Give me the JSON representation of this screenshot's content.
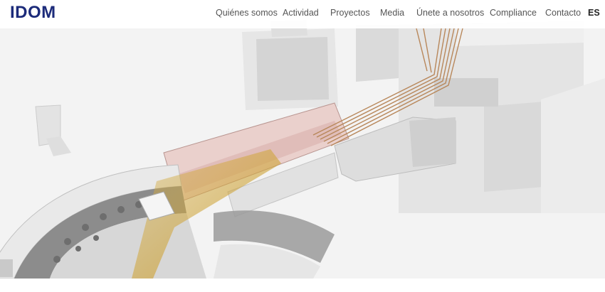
{
  "header": {
    "logo_text": "IDOM",
    "nav": [
      {
        "label": "Quiénes somos"
      },
      {
        "label": "Actividad"
      },
      {
        "label": "Proyectos"
      },
      {
        "label": "Media"
      },
      {
        "label": "Únete a nosotros"
      },
      {
        "label": "Compliance"
      },
      {
        "label": "Contacto"
      }
    ],
    "language": "ES"
  },
  "colors": {
    "brand": "#1c2b7a",
    "nav_text": "#555555",
    "highlight_pink": "#e8c4c0",
    "beam_gold": "#d6b048",
    "cable_copper": "#b8875a"
  }
}
